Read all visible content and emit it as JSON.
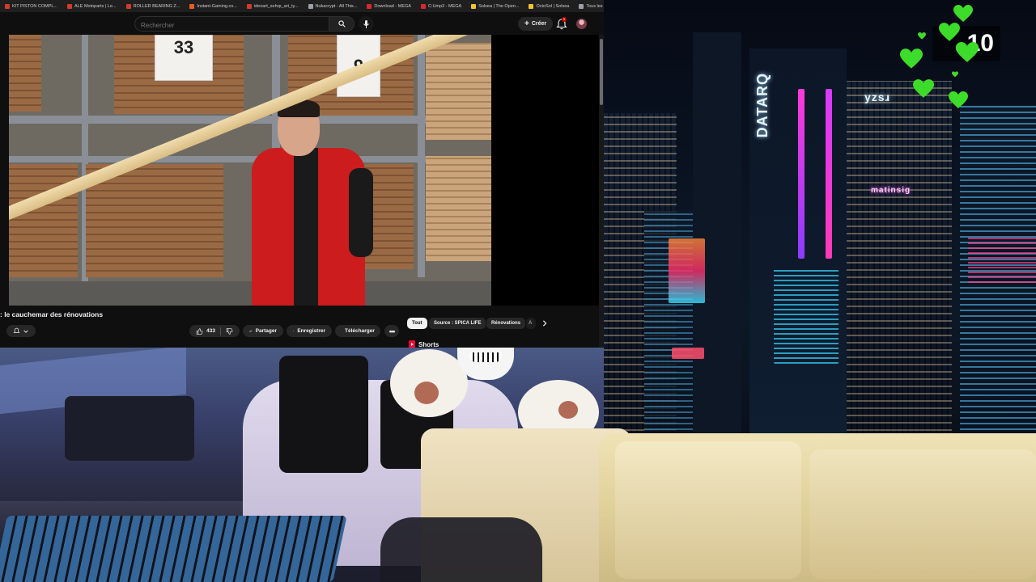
{
  "bookmarks": [
    {
      "label": "KIT PISTON COMPL...",
      "color": "#d33a2c"
    },
    {
      "label": "ALE Motoparts | Le...",
      "color": "#d33a2c"
    },
    {
      "label": "ROLLER BEARING Z...",
      "color": "#d33a2c"
    },
    {
      "label": "Instant-Gaming.co...",
      "color": "#e85d1f"
    },
    {
      "label": "ideoart_sehrp_art_ty...",
      "color": "#d33a2c"
    },
    {
      "label": "Nukacrypt - All This...",
      "color": "#9aa0a6"
    },
    {
      "label": "Download - MEGA",
      "color": "#d9272e"
    },
    {
      "label": "C:Ump3 - MEGA",
      "color": "#d9272e"
    },
    {
      "label": "Solsea | The Open...",
      "color": "#f1c232"
    },
    {
      "label": "OctoSol | Solsea",
      "color": "#f1c232"
    },
    {
      "label": "Tous les favoris",
      "color": "#9aa0a6"
    }
  ],
  "header": {
    "search_placeholder": "Rechercher",
    "create_label": "Créer",
    "notification_count": "9"
  },
  "video": {
    "price_card_1": "33",
    "price_card_2": "9",
    "title": ": le cauchemar des rénovations"
  },
  "actions": {
    "like_count": "433",
    "share_label": "Partager",
    "save_label": "Enregistrer",
    "download_label": "Télécharger"
  },
  "chips": [
    "Tout",
    "Source : SPICA LIFE",
    "Rénovations",
    "A"
  ],
  "shorts_label": "Shorts",
  "counter_value": "10",
  "city_signs": {
    "vertical_sign": "DATARQ",
    "top_sign": "yzsɹ",
    "sign_small": "matinsig"
  },
  "colors": {
    "accent_red": "#cc0000",
    "chip_active_bg": "#f1f1f1",
    "heart_green": "#3ddc2a"
  }
}
